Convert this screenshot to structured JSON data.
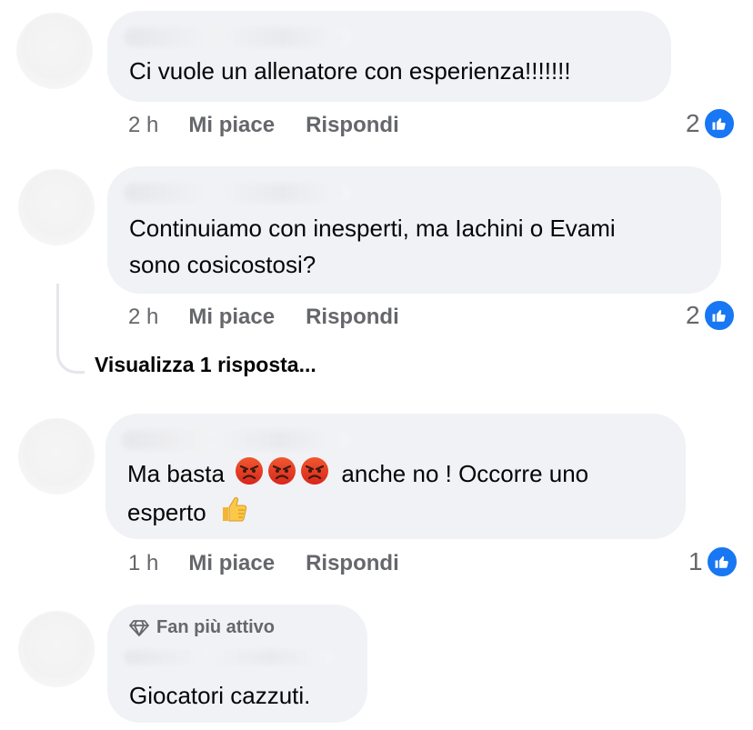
{
  "comments": [
    {
      "text_lines": [
        "Ci vuole un allenatore con esperienza!!!!!!!"
      ],
      "time": "2 h",
      "like_label": "Mi piace",
      "reply_label": "Rispondi",
      "reaction_count": "2"
    },
    {
      "text_lines": [
        "Continuiamo con inesperti, ma Iachini o Evami",
        "sono cosicostosi?"
      ],
      "time": "2 h",
      "like_label": "Mi piace",
      "reply_label": "Rispondi",
      "reaction_count": "2",
      "view_replies": "Visualizza 1 risposta..."
    },
    {
      "text_line1_before": "Ma basta",
      "text_line1_after": "anche no ! Occorre uno",
      "text_line2": "esperto",
      "emojis": [
        "angry-face-emoji",
        "angry-face-emoji",
        "angry-face-emoji",
        "thumbs-up-emoji"
      ],
      "time": "1 h",
      "like_label": "Mi piace",
      "reply_label": "Rispondi",
      "reaction_count": "1"
    },
    {
      "badge": "Fan più attivo",
      "text_lines": [
        "Giocatori cazzuti."
      ]
    }
  ],
  "colors": {
    "bubble_bg": "#f0f2f5",
    "secondary_text": "#65676b",
    "like_blue": "#1877f2",
    "angry_red": "#e9402e"
  }
}
